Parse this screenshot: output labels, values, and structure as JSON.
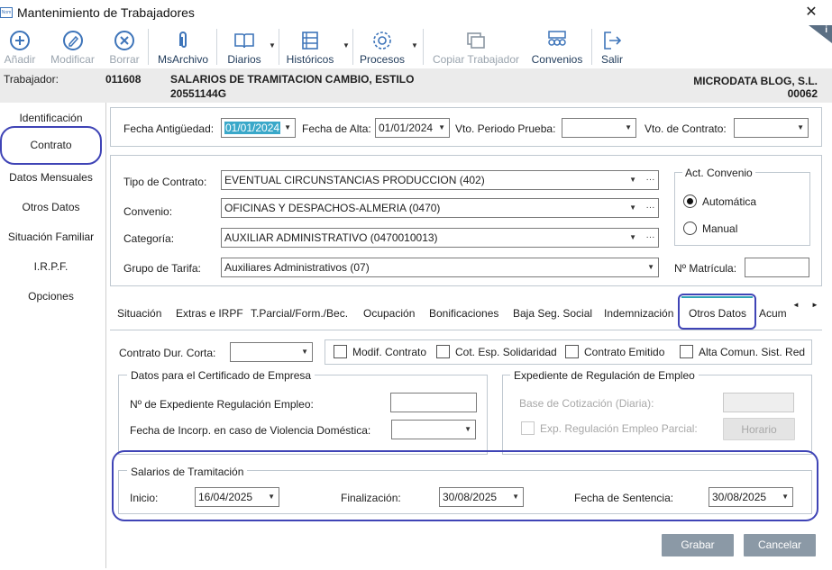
{
  "window": {
    "title": "Mantenimiento de Trabajadores",
    "app_icon_text": "Nom"
  },
  "toolbar": {
    "add": "Añadir",
    "modify": "Modificar",
    "delete": "Borrar",
    "msarchivo": "MsArchivo",
    "diarios": "Diarios",
    "historicos": "Históricos",
    "procesos": "Procesos",
    "copy_worker": "Copiar Trabajador",
    "convenios": "Convenios",
    "exit": "Salir"
  },
  "worker": {
    "label": "Trabajador:",
    "code": "011608",
    "name": "SALARIOS DE TRAMITACION CAMBIO, ESTILO",
    "nif": "20551144G",
    "company": "MICRODATA BLOG, S.L.",
    "company_code": "00062"
  },
  "nav": {
    "items": [
      "Identificación",
      "Contrato",
      "Datos Mensuales",
      "Otros Datos",
      "Situación Familiar",
      "I.R.P.F.",
      "Opciones"
    ],
    "selected": "Contrato"
  },
  "dates": {
    "antiguedad_label": "Fecha Antigüedad:",
    "antiguedad_value": "01/01/2024",
    "alta_label": "Fecha de Alta:",
    "alta_value": "01/01/2024",
    "periodo_prueba_label": "Vto. Periodo Prueba:",
    "periodo_prueba_value": "",
    "vto_contrato_label": "Vto. de Contrato:",
    "vto_contrato_value": ""
  },
  "contract": {
    "tipo_label": "Tipo de Contrato:",
    "tipo_value": "EVENTUAL CIRCUNSTANCIAS PRODUCCION (402)",
    "convenio_label": "Convenio:",
    "convenio_value": "OFICINAS Y DESPACHOS-ALMERIA (0470)",
    "categoria_label": "Categoría:",
    "categoria_value": "AUXILIAR ADMINISTRATIVO (0470010013)",
    "grupo_label": "Grupo de Tarifa:",
    "grupo_value": "Auxiliares Administrativos (07)",
    "matricula_label": "Nº Matrícula:",
    "matricula_value": "",
    "act_convenio_title": "Act. Convenio",
    "opt_auto": "Automática",
    "opt_manual": "Manual",
    "act_convenio_selected": "Automática"
  },
  "tabs": {
    "items": [
      "Situación",
      "Extras e IRPF",
      "T.Parcial/Form./Bec.",
      "Ocupación",
      "Bonificaciones",
      "Baja Seg. Social",
      "Indemnización",
      "Otros Datos",
      "Acum"
    ],
    "selected": "Otros Datos"
  },
  "otros": {
    "dur_corta_label": "Contrato Dur. Corta:",
    "dur_corta_value": "",
    "modif_contrato": "Modif. Contrato",
    "cot_esp": "Cot. Esp. Solidaridad",
    "contrato_emitido": "Contrato Emitido",
    "alta_comun": "Alta Comun. Sist. Red",
    "cert_title": "Datos para el Certificado de Empresa",
    "expediente_label": "Nº de Expediente Regulación Empleo:",
    "expediente_value": "",
    "violencia_label": "Fecha de Incorp. en caso de Violencia Doméstica:",
    "violencia_value": "",
    "ere_title": "Expediente de Regulación de Empleo",
    "base_label": "Base de Cotización (Diaria):",
    "base_value": "",
    "exp_parcial": "Exp. Regulación Empleo Parcial:",
    "horario": "Horario"
  },
  "salarios": {
    "title": "Salarios de Tramitación",
    "inicio_label": "Inicio:",
    "inicio_value": "16/04/2025",
    "fin_label": "Finalización:",
    "fin_value": "30/08/2025",
    "sentencia_label": "Fecha de Sentencia:",
    "sentencia_value": "30/08/2025"
  },
  "actions": {
    "save": "Grabar",
    "cancel": "Cancelar"
  },
  "colors": {
    "highlight": "#3f44b6",
    "button": "#8b99a6",
    "selected_date": "#3aa8c9",
    "icon": "#3d74b9"
  }
}
